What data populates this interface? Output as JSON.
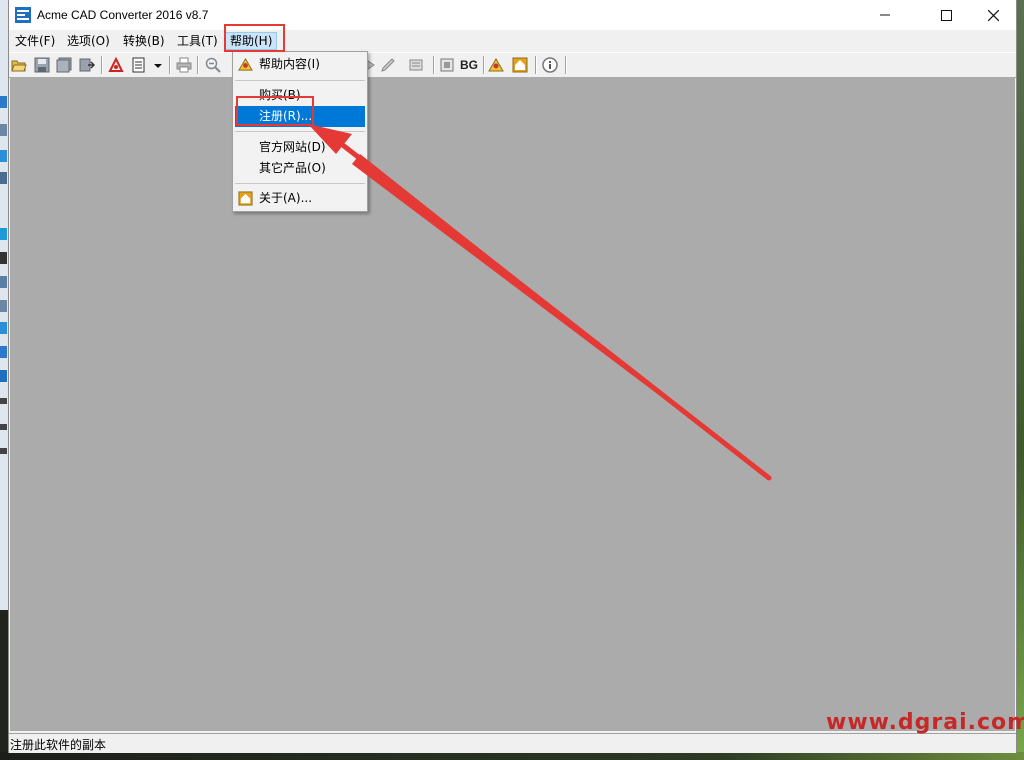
{
  "window": {
    "title": "Acme CAD Converter 2016 v8.7",
    "controls": {
      "minimize": "—",
      "maximize": "☐",
      "close": "✕"
    }
  },
  "menubar": {
    "items": [
      {
        "label": "文件(F)"
      },
      {
        "label": "选项(O)"
      },
      {
        "label": "转换(B)"
      },
      {
        "label": "工具(T)"
      },
      {
        "label": "帮助(H)",
        "active": true
      }
    ]
  },
  "toolbar": {
    "bg_label": "BG",
    "icons": [
      "open-folder-icon",
      "save-icon",
      "save-all-icon",
      "export-icon",
      "pdf-convert-icon",
      "batch-convert-icon",
      "dropdown-arrow-icon",
      "print-icon",
      "zoom-out-icon",
      "layers-icon",
      "pen-icon",
      "list-icon",
      "settings-icon",
      "help-icon",
      "home-icon",
      "info-icon"
    ]
  },
  "help_menu": {
    "items": [
      {
        "label": "帮助内容(I)",
        "icon": "help-content-icon"
      },
      {
        "label": "购买(B)"
      },
      {
        "label": "注册(R)...",
        "highlighted": true
      },
      {
        "label": "官方网站(D)"
      },
      {
        "label": "其它产品(O)"
      },
      {
        "label": "关于(A)...",
        "icon": "home-icon"
      }
    ]
  },
  "statusbar": {
    "text": "注册此软件的副本"
  },
  "watermark": "www.dgrai.com",
  "colors": {
    "annotation": "#e53935",
    "highlight": "#0078d7",
    "client_bg": "#ababab"
  }
}
